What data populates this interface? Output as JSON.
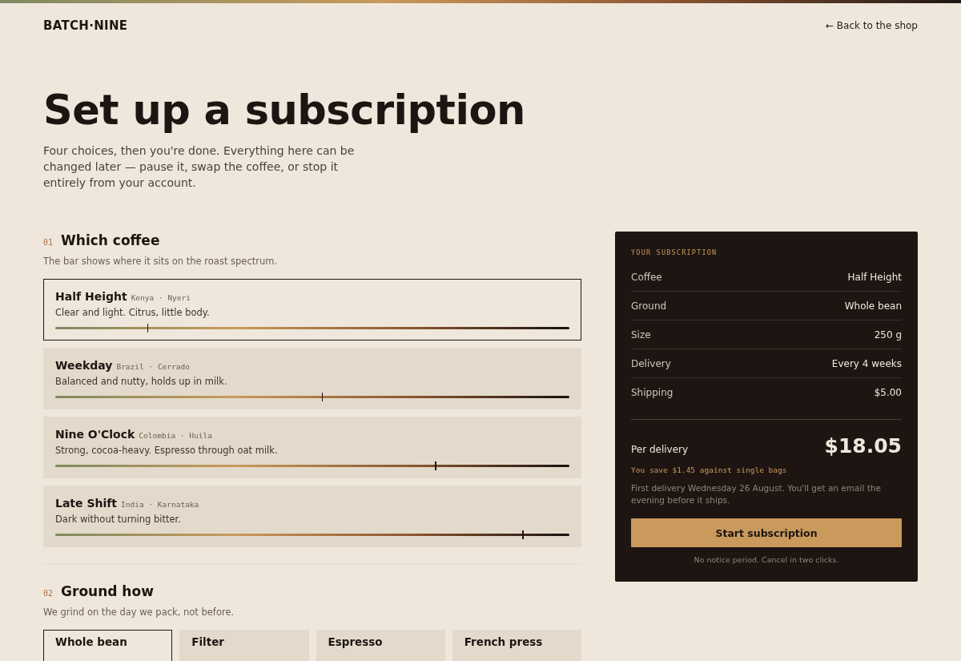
{
  "brand": "BATCH·NINE",
  "back_link": "← Back to the shop",
  "title": "Set up a subscription",
  "intro": "Four choices, then you're done. Everything here can be changed later — pause it, swap the coffee, or stop it entirely from your account.",
  "sections": [
    {
      "number": "01",
      "heading": "Which coffee",
      "note": "The bar shows where it sits on the roast spectrum.",
      "kind": "coffee",
      "options": [
        {
          "name": "Half Height",
          "origin": "Kenya · Nyeri",
          "description": "Clear and light. Citrus, little body.",
          "level": 0.18,
          "selected": true
        },
        {
          "name": "Weekday",
          "origin": "Brazil · Cerrado",
          "description": "Balanced and nutty, holds up in milk.",
          "level": 0.52,
          "selected": false
        },
        {
          "name": "Nine O'Clock",
          "origin": "Colombia · Huila",
          "description": "Strong, cocoa-heavy. Espresso through oat milk.",
          "level": 0.74,
          "selected": false
        },
        {
          "name": "Late Shift",
          "origin": "India · Karnataka",
          "description": "Dark without turning bitter.",
          "level": 0.91,
          "selected": false
        }
      ]
    },
    {
      "number": "02",
      "heading": "Ground how",
      "note": "We grind on the day we pack, not before.",
      "kind": "grind",
      "options": [
        {
          "name": "Whole bean",
          "selected": true
        },
        {
          "name": "Filter",
          "selected": false
        },
        {
          "name": "Espresso",
          "selected": false
        },
        {
          "name": "French press",
          "selected": false
        }
      ]
    }
  ],
  "summary": {
    "heading": "YOUR SUBSCRIPTION",
    "rows": [
      {
        "label": "Coffee",
        "value": "Half Height"
      },
      {
        "label": "Ground",
        "value": "Whole bean"
      },
      {
        "label": "Size",
        "value": "250 g"
      },
      {
        "label": "Delivery",
        "value": "Every 4 weeks"
      },
      {
        "label": "Shipping",
        "value": "$5.00"
      }
    ],
    "total_label": "Per delivery",
    "total": "$18.05",
    "savings": "You save $1.45 against single bags",
    "delivery_note": "First delivery Wednesday 26 August. You'll get an email the evening before it ships.",
    "button": "Start subscription",
    "footnote": "No notice period. Cancel in two clicks."
  }
}
